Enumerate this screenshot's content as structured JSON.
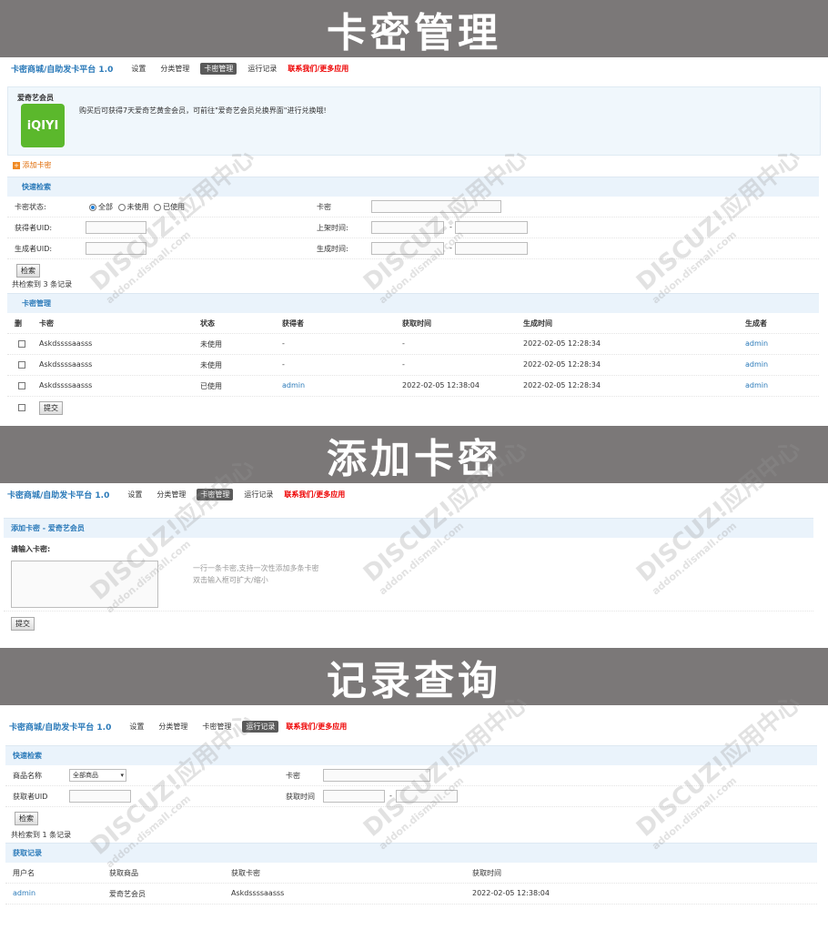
{
  "banners": [
    "卡密管理",
    "添加卡密",
    "记录查询"
  ],
  "nav": {
    "brand": "卡密商城/自助发卡平台 1.0",
    "items": [
      "设置",
      "分类管理",
      "卡密管理",
      "运行记录"
    ],
    "contact": "联系我们/更多应用"
  },
  "panel1": {
    "product_name": "爱奇艺会员",
    "product_logo_text": "iQIYI",
    "description": "购买后可获得7天爱奇艺黄金会员，可前往\"爱奇艺会员兑换界面\"进行兑换哦!",
    "add_card": "添加卡密",
    "search_head": "快速检索",
    "status_label": "卡密状态:",
    "status_options": [
      "全部",
      "未使用",
      "已使用"
    ],
    "card_label": "卡密",
    "getter_label": "获得者UID:",
    "shelf_time_label": "上架时间:",
    "creator_label": "生成者UID:",
    "create_time_label": "生成时间:",
    "range_sep": "-",
    "search_btn": "检索",
    "result_count": "共检索到 3 条记录",
    "table_head": "卡密管理",
    "columns": [
      "删",
      "卡密",
      "状态",
      "获得者",
      "获取时间",
      "生成时间",
      "生成者"
    ],
    "rows": [
      {
        "card": "Askdssssaasss",
        "status": "未使用",
        "getter": "-",
        "get_time": "-",
        "create_time": "2022-02-05 12:28:34",
        "creator": "admin"
      },
      {
        "card": "Askdssssaasss",
        "status": "未使用",
        "getter": "-",
        "get_time": "-",
        "create_time": "2022-02-05 12:28:34",
        "creator": "admin"
      },
      {
        "card": "Askdssssaasss",
        "status": "已使用",
        "getter": "admin",
        "get_time": "2022-02-05 12:38:04",
        "create_time": "2022-02-05 12:28:34",
        "creator": "admin"
      }
    ],
    "submit_btn": "提交"
  },
  "panel2": {
    "head": "添加卡密 - 爱奇艺会员",
    "input_label": "请输入卡密:",
    "hint1": "一行一条卡密,支持一次性添加多条卡密",
    "hint2": "双击输入框可扩大/缩小",
    "submit_btn": "提交"
  },
  "panel3": {
    "search_head": "快速检索",
    "product_label": "商品名称",
    "product_select": "全部商品",
    "card_label": "卡密",
    "getter_label": "获取者UID",
    "get_time_label": "获取时间",
    "range_sep": "-",
    "search_btn": "检索",
    "result_count": "共检索到 1 条记录",
    "table_head": "获取记录",
    "columns": [
      "用户名",
      "获取商品",
      "获取卡密",
      "获取时间"
    ],
    "rows": [
      {
        "user": "admin",
        "product": "爱奇艺会员",
        "card": "Askdssssaasss",
        "time": "2022-02-05 12:38:04"
      }
    ]
  },
  "watermark": {
    "main": "DISCUZ!应用中心",
    "sub": "addon.dismall.com",
    "mark": "贰道"
  }
}
